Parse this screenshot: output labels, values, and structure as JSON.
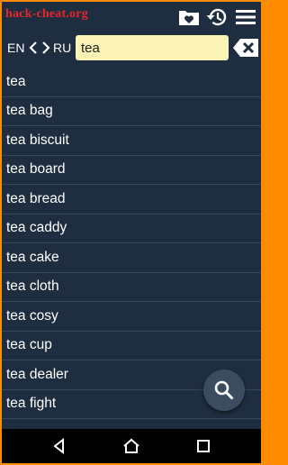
{
  "watermark": "hack-cheat.org",
  "toolbar": {
    "favorites_icon": "heart-folder-icon",
    "history_icon": "history-icon",
    "menu_icon": "menu-icon"
  },
  "search": {
    "lang_from": "EN",
    "lang_to": "RU",
    "query": "tea"
  },
  "results": [
    "tea",
    "tea bag",
    "tea biscuit",
    "tea board",
    "tea bread",
    "tea caddy",
    "tea cake",
    "tea cloth",
    "tea cosy",
    "tea cup",
    "tea dealer",
    "tea fight"
  ],
  "colors": {
    "frame": "#ff8c00",
    "background": "#1e2d40",
    "input_bg": "#fbf3b6",
    "watermark": "#e8262a"
  }
}
